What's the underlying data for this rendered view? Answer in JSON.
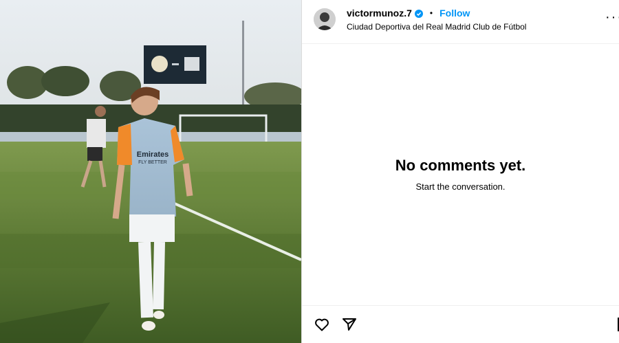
{
  "post": {
    "username": "victormunoz.7",
    "verified": true,
    "separator": "•",
    "follow_label": "Follow",
    "location": "Ciudad Deportiva del Real Madrid Club de Fútbol"
  },
  "comments": {
    "empty_title": "No comments yet.",
    "empty_subtitle": "Start the conversation."
  },
  "photo": {
    "jersey_text_1": "Emirates",
    "jersey_text_2": "FLY BETTER"
  },
  "icons": {
    "like": "heart-icon",
    "share": "paper-plane-icon",
    "more": "more-options-icon",
    "verified": "verified-badge-icon"
  },
  "colors": {
    "accent": "#0095f6",
    "text": "#000000",
    "divider": "#efefef"
  }
}
